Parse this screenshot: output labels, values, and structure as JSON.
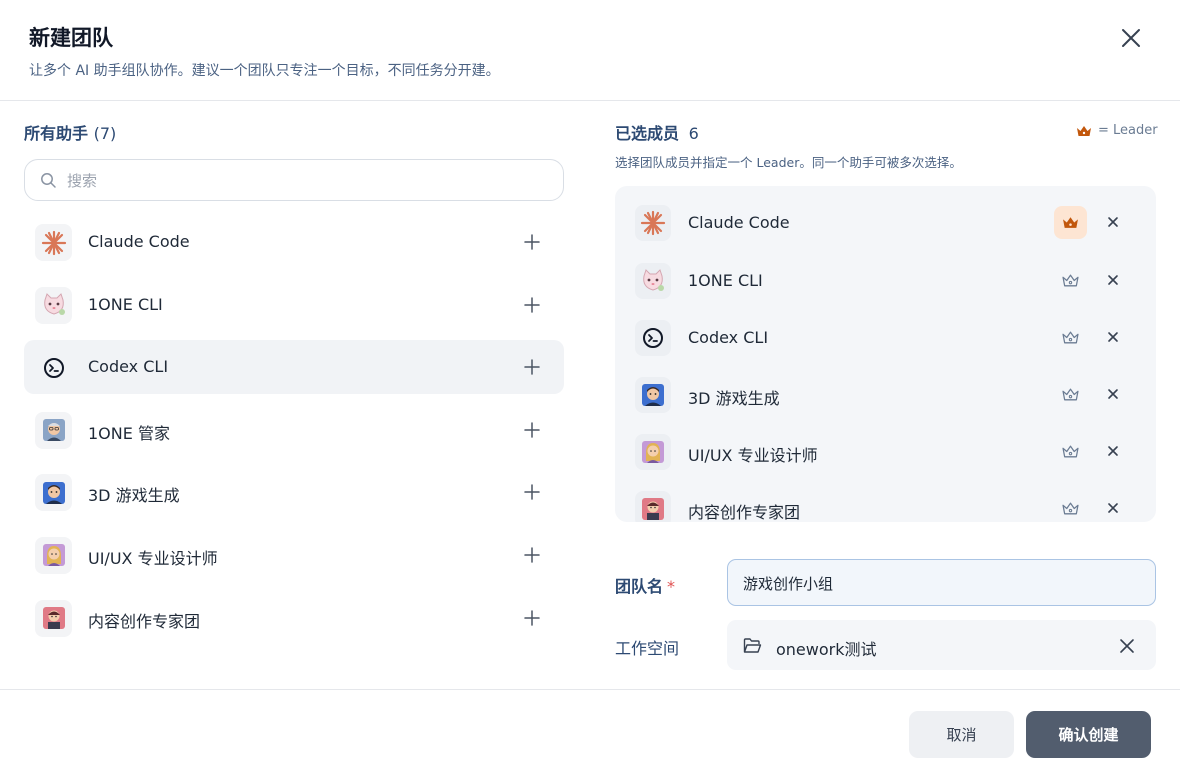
{
  "dialog": {
    "title": "新建团队",
    "subtitle": "让多个 AI 助手组队协作。建议一个团队只专注一个目标，不同任务分开建。"
  },
  "all_agents": {
    "heading": "所有助手",
    "count": "(7)",
    "search_placeholder": "搜索",
    "items": [
      {
        "name": "Claude Code",
        "icon": "claude-sparkle-icon"
      },
      {
        "name": "1ONE CLI",
        "icon": "cat-avatar-icon"
      },
      {
        "name": "Codex CLI",
        "icon": "codex-terminal-icon"
      },
      {
        "name": "1ONE 管家",
        "icon": "butler-avatar-icon"
      },
      {
        "name": "3D 游戏生成",
        "icon": "gamer-avatar-icon"
      },
      {
        "name": "UI/UX 专业设计师",
        "icon": "designer-avatar-icon"
      },
      {
        "name": "内容创作专家团",
        "icon": "creator-avatar-icon"
      }
    ]
  },
  "selected": {
    "heading": "已选成员",
    "count": "6",
    "legend": "= Leader",
    "subtitle": "选择团队成员并指定一个 Leader。同一个助手可被多次选择。",
    "items": [
      {
        "name": "Claude Code",
        "leader": true
      },
      {
        "name": "1ONE CLI",
        "leader": false
      },
      {
        "name": "Codex CLI",
        "leader": false
      },
      {
        "name": "3D 游戏生成",
        "leader": false
      },
      {
        "name": "UI/UX 专业设计师",
        "leader": false
      },
      {
        "name": "内容创作专家团",
        "leader": false
      }
    ]
  },
  "form": {
    "team_name_label": "团队名",
    "required_mark": "*",
    "team_name_value": "游戏创作小组",
    "workspace_label": "工作空间",
    "workspace_value": "onework测试"
  },
  "footer": {
    "cancel": "取消",
    "confirm": "确认创建"
  },
  "colors": {
    "accent": "#2d4a73",
    "leader": "#c2570c",
    "confirm_bg": "#525d6e"
  }
}
